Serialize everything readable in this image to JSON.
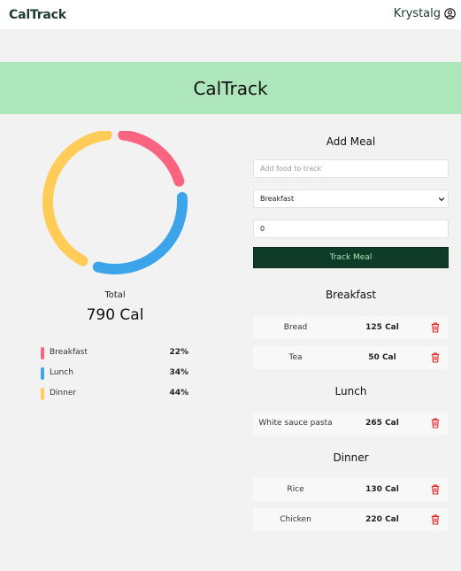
{
  "navbar": {
    "brand": "CalTrack",
    "user_name": "Krystalg",
    "user_icon": "user-circle-icon"
  },
  "hero": {
    "title": "CalTrack"
  },
  "summary": {
    "total_label": "Total",
    "total_value": "790 Cal",
    "segments": [
      {
        "name": "Breakfast",
        "percent": "22%",
        "fraction": 0.22,
        "color": "#fb6480"
      },
      {
        "name": "Lunch",
        "percent": "34%",
        "fraction": 0.34,
        "color": "#3ca5ea"
      },
      {
        "name": "Dinner",
        "percent": "44%",
        "fraction": 0.44,
        "color": "#ffcd57"
      }
    ]
  },
  "add_meal": {
    "title": "Add Meal",
    "food_placeholder": "Add food to track",
    "meal_select": "Breakfast",
    "calories_value": "0",
    "track_label": "Track Meal"
  },
  "meals": [
    {
      "title": "Breakfast",
      "items": [
        {
          "name": "Bread",
          "cal": "125 Cal"
        },
        {
          "name": "Tea",
          "cal": "50 Cal"
        }
      ]
    },
    {
      "title": "Lunch",
      "items": [
        {
          "name": "White sauce pasta",
          "cal": "265 Cal"
        }
      ]
    },
    {
      "title": "Dinner",
      "items": [
        {
          "name": "Rice",
          "cal": "130 Cal"
        },
        {
          "name": "Chicken",
          "cal": "220 Cal"
        }
      ]
    }
  ],
  "colors": {
    "accent_dark": "#0f3b29",
    "accent_light": "#ade6bb",
    "delete": "#e02424"
  }
}
